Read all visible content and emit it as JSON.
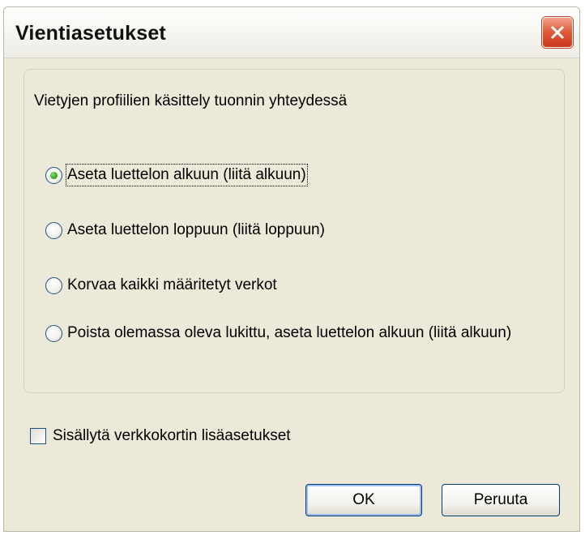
{
  "window": {
    "title": "Vientiasetukset"
  },
  "group": {
    "label": "Vietyjen profiilien käsittely tuonnin yhteydessä",
    "options": [
      {
        "label": "Aseta luettelon alkuun (liitä alkuun)",
        "selected": true
      },
      {
        "label": "Aseta luettelon loppuun (liitä loppuun)",
        "selected": false
      },
      {
        "label": "Korvaa kaikki määritetyt verkot",
        "selected": false
      },
      {
        "label": "Poista olemassa oleva lukittu, aseta luettelon alkuun (liitä alkuun)",
        "selected": false
      }
    ]
  },
  "checkbox": {
    "label": "Sisällytä verkkokortin lisäasetukset",
    "checked": false
  },
  "buttons": {
    "ok": "OK",
    "cancel": "Peruuta"
  },
  "icons": {
    "close": "close-icon"
  },
  "colors": {
    "dialog_bg": "#ece9d8",
    "close_button": "#e0583a",
    "radio_selected": "#2f9e1c",
    "border_blue": "#1c5180"
  }
}
